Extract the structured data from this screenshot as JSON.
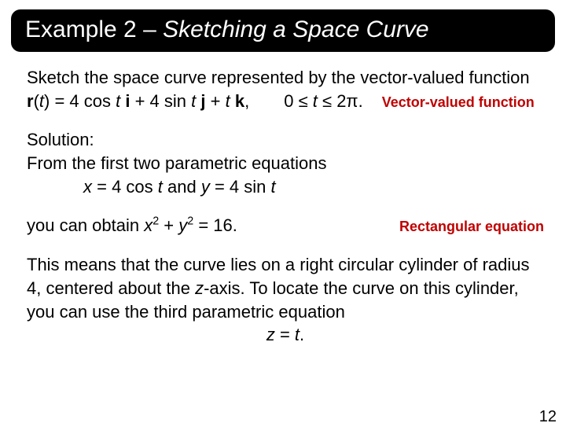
{
  "title": {
    "prefix": "Example 2 – ",
    "italic": "Sketching a Space Curve"
  },
  "p_intro": "Sketch the space curve represented by the vector-valued function",
  "r": "r",
  "t": "t",
  "eq_r1": "(",
  "eq_r2": ") = 4 cos ",
  "eq_r3": " ",
  "i_vec": "i",
  "eq_r4": " + 4 sin ",
  "j_vec": "j",
  "eq_r5": " + ",
  "k_vec": "k",
  "eq_r6": ",",
  "range": "0 ≤ ",
  "range2": " ≤ 2π.",
  "annot_vv": "Vector-valued function",
  "sol_label": "Solution:",
  "sol_line": "From the first two parametric equations",
  "x": "x",
  "y": "y",
  "z": "z",
  "param_eq1a": " = 4 cos ",
  "param_and": " and ",
  "param_eq2a": " = 4 sin ",
  "obtain_pre": "you can obtain ",
  "sup2": "2",
  "plus": "  + ",
  "eq16": "  = 16.",
  "annot_rect": "Rectangular equation",
  "p_cyl": "This means that the curve lies on a right circular cylinder of radius 4, centered about the ",
  "zaxis": "-axis. To locate the curve on this cylinder, you can use the third parametric equation",
  "z_eq": " = ",
  "dot": ".",
  "page": "12"
}
